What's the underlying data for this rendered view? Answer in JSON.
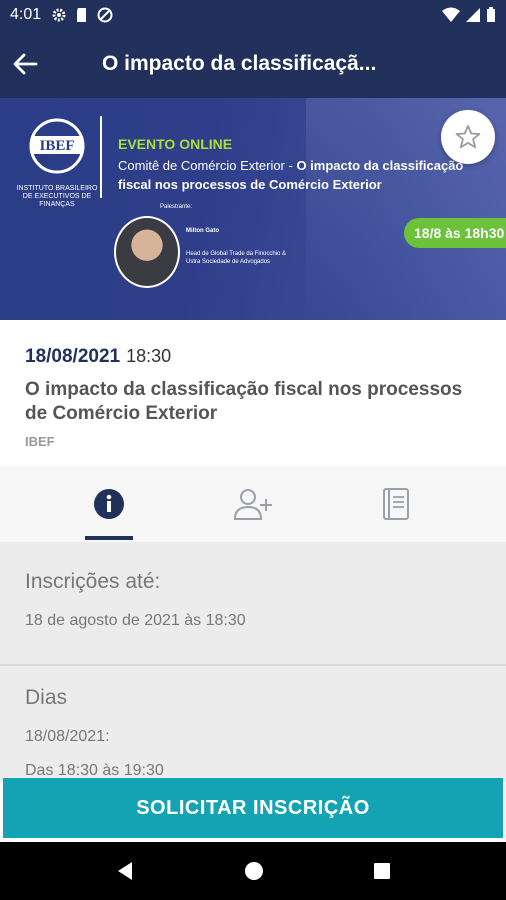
{
  "status": {
    "time": "4:01"
  },
  "appbar": {
    "title": "O impacto da classificaçã..."
  },
  "banner": {
    "logo": "IBEF",
    "logo_subtext": "INSTITUTO BRASILEIRO DE EXECUTIVOS DE FINANÇAS",
    "event_type": "EVENTO ONLINE",
    "line_prefix": "Comitê de Comércio Exterior - ",
    "line_bold": "O impacto da classificação fiscal nos processos de Comércio Exterior",
    "speaker_label": "Palestrante:",
    "speaker_name": "Milton Gato",
    "speaker_role": "Head de Global Trade da Finocchio & Ustra Sociedade de Advogados",
    "date_pill": "18/8 às 18h30"
  },
  "event": {
    "date": "18/08/2021",
    "hour": "18:30",
    "title": "O impacto da classificação fiscal nos processos de Comércio Exterior",
    "organizer": "IBEF"
  },
  "sections": {
    "subscriptions_title": "Inscrições até:",
    "subscriptions_value": "18 de agosto de 2021 às 18:30",
    "days_title": "Dias",
    "days_date": "18/08/2021:",
    "days_time": "Das 18:30 às 19:30"
  },
  "cta": {
    "label": "SOLICITAR INSCRIÇÃO"
  },
  "colors": {
    "primary": "#22305c",
    "accent": "#14a3b3",
    "green": "#6cc23a"
  },
  "icons": [
    "info-icon",
    "add-user-icon",
    "book-icon",
    "star-icon",
    "back-arrow-icon"
  ]
}
